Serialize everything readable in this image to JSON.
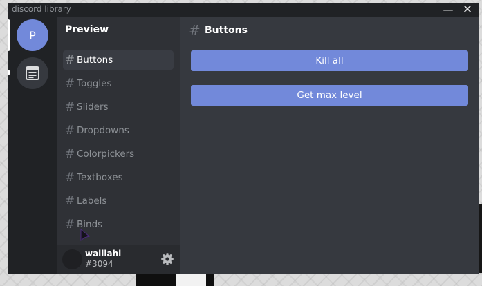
{
  "window": {
    "title": "discord library",
    "minimize_icon": "minimize-icon",
    "close_icon": "close-icon"
  },
  "servers": [
    {
      "label": "P",
      "color": "#7289da",
      "active": true
    },
    {
      "icon": "document-icon",
      "active": false
    }
  ],
  "sidebar": {
    "title": "Preview",
    "channels": [
      {
        "label": "Buttons",
        "active": true
      },
      {
        "label": "Toggles"
      },
      {
        "label": "Sliders"
      },
      {
        "label": "Dropdowns"
      },
      {
        "label": "Colorpickers"
      },
      {
        "label": "Textboxes"
      },
      {
        "label": "Labels"
      },
      {
        "label": "Binds"
      }
    ]
  },
  "user": {
    "name": "walllahi",
    "tag": "#3094",
    "settings_icon": "gear-icon"
  },
  "main": {
    "channel_title": "Buttons",
    "buttons": [
      {
        "label": "Kill all"
      },
      {
        "label": "Get max level"
      }
    ]
  },
  "colors": {
    "accent": "#7289da",
    "rail": "#202225",
    "panel": "#2f3136",
    "content": "#36393f"
  }
}
